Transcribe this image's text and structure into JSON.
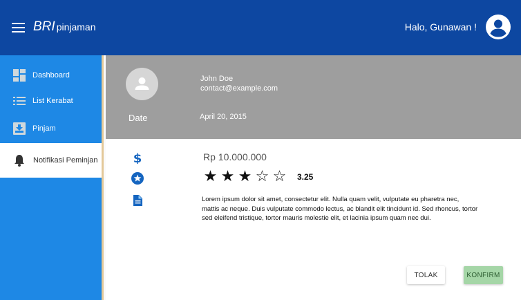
{
  "header": {
    "brand": "BRI",
    "brand_sub": "pinjaman",
    "greeting": "Halo, Gunawan !",
    "icons": {
      "menu": "menu-icon",
      "account": "account-circle-icon"
    }
  },
  "sidebar": {
    "items": [
      {
        "label": "Dashboard",
        "icon": "dashboard-icon",
        "active": false
      },
      {
        "label": "List Kerabat",
        "icon": "list-icon",
        "active": false
      },
      {
        "label": "Pinjam",
        "icon": "inbox-download-icon",
        "active": false
      },
      {
        "label": "Notifikasi Peminjan",
        "icon": "bell-icon",
        "active": true
      }
    ]
  },
  "card": {
    "header": {
      "name": "John Doe",
      "email": "contact@example.com",
      "date_label": "Date",
      "date_value": "April 20, 2015"
    },
    "body": {
      "amount": "Rp 10.000.000",
      "rating_value": "3.25",
      "stars_filled": 3,
      "stars_total": 5,
      "description": "Lorem ipsum dolor sit amet, consectetur elit. Nulla quam velit, vulputate eu pharetra nec, mattis ac neque. Duis vulputate commodo lectus, ac blandit elit tincidunt id. Sed rhoncus, tortor sed eleifend tristique, tortor mauris molestie elit, et lacinia ipsum quam nec dui.",
      "icons": [
        "dollar-icon",
        "star-badge-icon",
        "document-icon"
      ]
    },
    "actions": {
      "reject": "TOLAK",
      "confirm": "KONFIRM"
    }
  },
  "colors": {
    "appbar": "#0d47a1",
    "sidebar": "#1e88e5",
    "card_header": "#9e9e9e",
    "icon_blue": "#1565c0",
    "confirm": "#a5d6a7"
  }
}
